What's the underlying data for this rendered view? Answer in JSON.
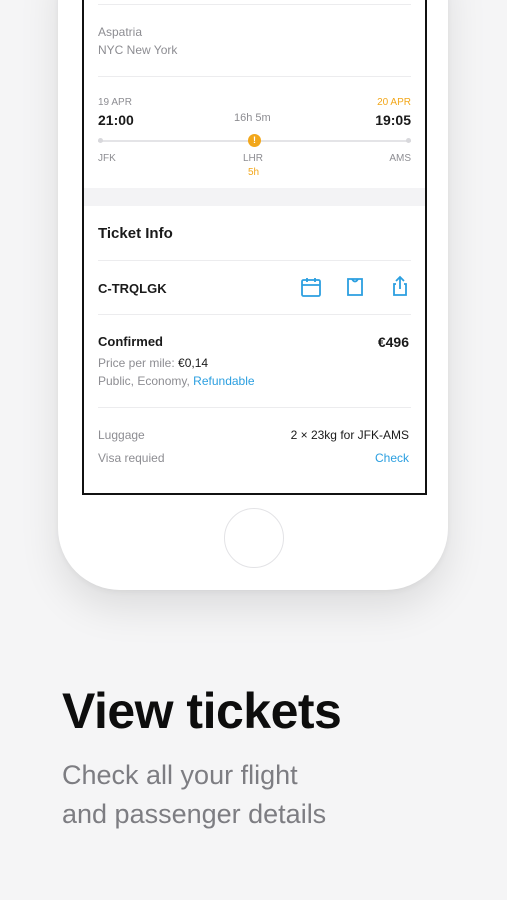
{
  "passenger": {
    "name": "Aspatria",
    "location": "NYC New York"
  },
  "flight": {
    "depart_date": "19 APR",
    "depart_time": "21:00",
    "duration": "16h 5m",
    "arrive_date": "20 APR",
    "arrive_time": "19:05",
    "stop_icon_glyph": "!",
    "origin": "JFK",
    "stop": "LHR",
    "stop_duration": "5h",
    "destination": "AMS"
  },
  "ticket": {
    "section_title": "Ticket Info",
    "code": "C-TRQLGK",
    "status": "Confirmed",
    "price": "€496",
    "price_per_mile_label": "Price per mile:",
    "price_per_mile_value": "€0,14",
    "fare_info": "Public, Economy,",
    "refundable_link": "Refundable",
    "luggage_label": "Luggage",
    "luggage_value": "2 × 23kg for JFK-AMS",
    "visa_label": "Visa requied",
    "visa_link": "Check",
    "icons": [
      "calendar-icon",
      "ticket-icon",
      "share-icon"
    ]
  },
  "promo": {
    "headline": "View tickets",
    "subtitle_line1": "Check all your flight",
    "subtitle_line2": "and passenger details"
  },
  "colors": {
    "accent_blue": "#2b9fe0",
    "accent_orange": "#f2a71b"
  }
}
